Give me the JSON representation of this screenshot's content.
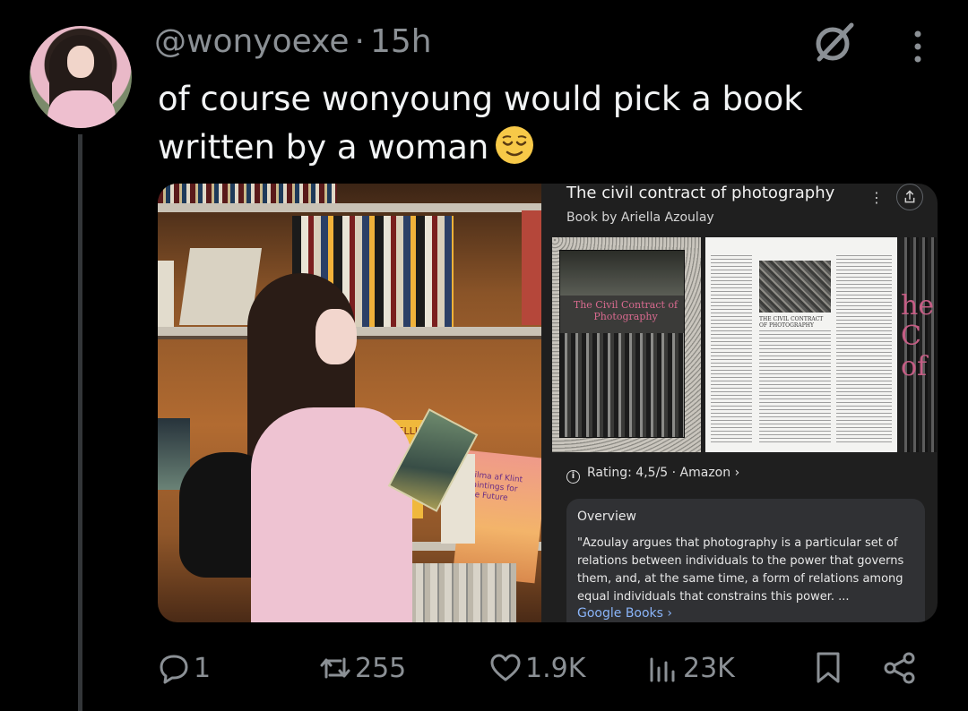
{
  "tweet": {
    "handle": "@wonyoexe",
    "separator": "·",
    "time": "15h",
    "text": "of course wonyoung would pick a book written by a woman",
    "emoji": "relieved-face-emoji"
  },
  "knowledge_panel": {
    "title": "The civil contract of photography",
    "subtitle": "Book by Ariella Azoulay",
    "menu_symbol": "⋮",
    "cover_title": "The Civil Contract of Photography",
    "page_heading": "THE CIVIL CONTRACT OF PHOTOGRAPHY",
    "partial_cover_text": "he C of",
    "rating": "Rating: 4,5/5 · Amazon ›",
    "overview_heading": "Overview",
    "overview_text": "\"Azoulay argues that photography is a particular set of relations between individuals to the power that governs them, and, at the same time, a form of relations among equal individuals that constrains this power. ...",
    "source_link": "Google Books ›"
  },
  "photo_left": {
    "book_labels": [
      "KOUNELLIS",
      "Hilma af Klint Paintings for the Future"
    ]
  },
  "actions": {
    "replies": "1",
    "reposts": "255",
    "likes": "1.9K",
    "views": "23K"
  },
  "colors": {
    "background": "#000000",
    "text": "#f2f4f5",
    "muted": "#8b9095",
    "link": "#8ab4f8",
    "thread_line": "#333639"
  }
}
